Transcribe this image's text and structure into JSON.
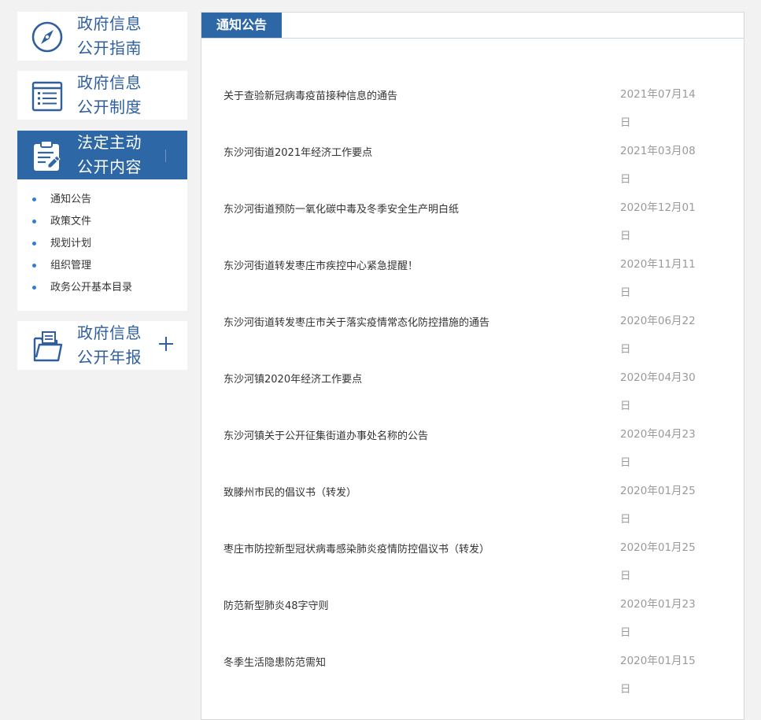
{
  "sidebar": {
    "guide": {
      "line1": "政府信息",
      "line2": "公开指南",
      "icon": "compass-icon"
    },
    "system": {
      "line1": "政府信息",
      "line2": "公开制度",
      "icon": "document-list-icon"
    },
    "content": {
      "line1": "法定主动",
      "line2": "公开内容",
      "icon": "clipboard-edit-icon"
    },
    "submenu": [
      {
        "label": "通知公告"
      },
      {
        "label": "政策文件"
      },
      {
        "label": "规划计划"
      },
      {
        "label": "组织管理"
      },
      {
        "label": "政务公开基本目录"
      }
    ],
    "annual": {
      "line1": "政府信息",
      "line2": "公开年报",
      "icon": "folder-document-icon",
      "expand_icon": "plus-icon"
    }
  },
  "main": {
    "tab_label": "通知公告",
    "notices": [
      {
        "title": "关于查验新冠病毒疫苗接种信息的通告",
        "date": "2021年07月14日"
      },
      {
        "title": "东沙河街道2021年经济工作要点",
        "date": "2021年03月08日"
      },
      {
        "title": "东沙河街道预防一氧化碳中毒及冬季安全生产明白纸",
        "date": "2020年12月01日"
      },
      {
        "title": "东沙河街道转发枣庄市疾控中心紧急提醒！",
        "date": "2020年11月11日"
      },
      {
        "title": "东沙河街道转发枣庄市关于落实疫情常态化防控措施的通告",
        "date": "2020年06月22日"
      },
      {
        "title": "东沙河镇2020年经济工作要点",
        "date": "2020年04月30日"
      },
      {
        "title": "东沙河镇关于公开征集街道办事处名称的公告",
        "date": "2020年04月23日"
      },
      {
        "title": "致滕州市民的倡议书（转发）",
        "date": "2020年01月25日"
      },
      {
        "title": "枣庄市防控新型冠状病毒感染肺炎疫情防控倡议书（转发）",
        "date": "2020年01月25日"
      },
      {
        "title": "防范新型肺炎48字守则",
        "date": "2020年01月23日"
      },
      {
        "title": "冬季生活隐患防范需知",
        "date": "2020年01月15日"
      }
    ]
  },
  "colors": {
    "accent": "#2d67a6",
    "title_blue": "#2f5f9e",
    "bullet": "#2f7fd0",
    "date_gray": "#9a9a9a",
    "page_bg": "#f2f2f2"
  }
}
